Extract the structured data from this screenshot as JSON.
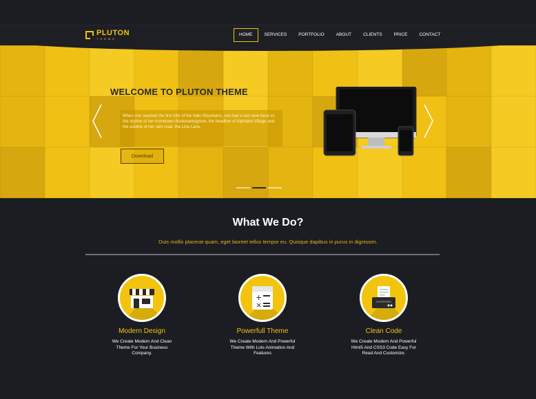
{
  "brand": {
    "name": "PLUTON",
    "tagline": "THEME",
    "accent": "#f2c40e"
  },
  "nav": {
    "items": [
      {
        "label": "HOME",
        "active": true
      },
      {
        "label": "SERVICES",
        "active": false
      },
      {
        "label": "PORTFOLIO",
        "active": false
      },
      {
        "label": "ABOUT",
        "active": false
      },
      {
        "label": "CLIENTS",
        "active": false
      },
      {
        "label": "PRICE",
        "active": false
      },
      {
        "label": "CONTACT",
        "active": false
      }
    ]
  },
  "hero": {
    "title": "WELCOME TO PLUTON THEME",
    "text": "When she reached the first hills of the Italic Mountains, she had a last view back on the skyline of her hometown Bookmarksgrove, the headline of Alphabet Village and the subline of her own road, the Line Lane.",
    "button_label": "Download",
    "slides": 3,
    "active_slide": 2,
    "icons": {
      "prev": "chevron-left-icon",
      "next": "chevron-right-icon"
    }
  },
  "services": {
    "title": "What We Do?",
    "subtitle": "Duis mollis placerat quam, eget laoreet tellus tempor eu. Quisque dapibus in purus in dignissim.",
    "features": [
      {
        "icon": "shop-icon",
        "title": "Modern Design",
        "text": "We Create Modern And Clean Theme For Your Business Company."
      },
      {
        "icon": "calculator-icon",
        "title": "Powerfull Theme",
        "text": "We Create Modern And Powerful Theme With Lots Animation And Features"
      },
      {
        "icon": "printer-icon",
        "title": "Clean Code",
        "text": "We Create Modern And Powerful Html5 And CSS3 Code Easy For Read And Customize."
      }
    ]
  }
}
